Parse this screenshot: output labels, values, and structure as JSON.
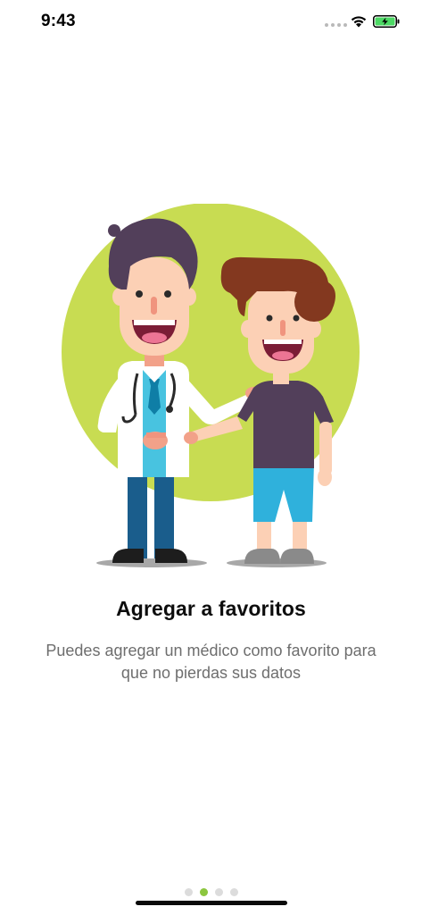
{
  "status_bar": {
    "time": "9:43"
  },
  "icons": {
    "signal": "signal-dots-icon",
    "wifi": "wifi-icon",
    "battery": "battery-charging-icon"
  },
  "colors": {
    "accent": "#8cc63f",
    "circle": "#c8dc52",
    "battery": "#4cd964"
  },
  "onboarding": {
    "title": "Agregar a favoritos",
    "description": "Puedes agregar un médico como favorito para que no pierdas sus datos",
    "page_count": 4,
    "active_page": 2
  }
}
